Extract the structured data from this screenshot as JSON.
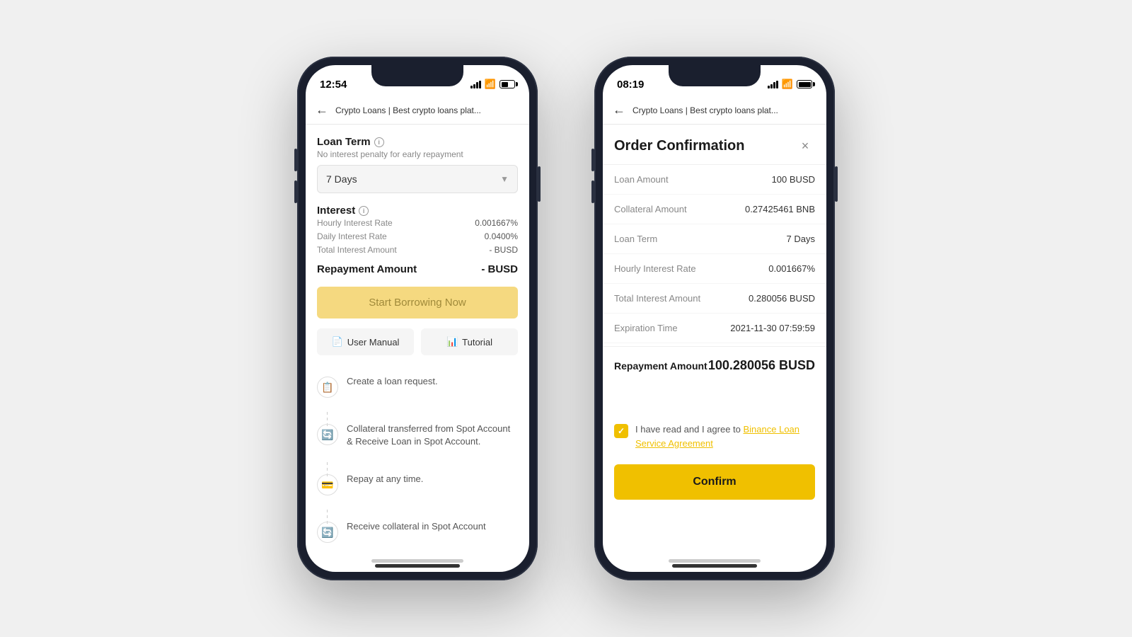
{
  "phone1": {
    "status": {
      "time": "12:54",
      "battery": "partial"
    },
    "browser": {
      "url": "Crypto Loans | Best crypto loans plat..."
    },
    "loanTerm": {
      "label": "Loan Term",
      "tooltip": "i",
      "subtext": "No interest penalty for early repayment",
      "selected": "7 Days"
    },
    "interest": {
      "label": "Interest",
      "tooltip": "i",
      "rows": [
        {
          "label": "Hourly Interest Rate",
          "value": "0.001667%"
        },
        {
          "label": "Daily Interest Rate",
          "value": "0.0400%"
        },
        {
          "label": "Total Interest Amount",
          "value": "- BUSD"
        }
      ]
    },
    "repayment": {
      "label": "Repayment Amount",
      "value": "- BUSD"
    },
    "borrowBtn": "Start Borrowing Now",
    "actionButtons": [
      {
        "label": "User Manual",
        "icon": "📄"
      },
      {
        "label": "Tutorial",
        "icon": "📊"
      }
    ],
    "steps": [
      {
        "text": "Create a loan request.",
        "icon": "📋"
      },
      {
        "text": "Collateral transferred from Spot Account & Receive Loan in Spot Account.",
        "icon": "🔄"
      },
      {
        "text": "Repay at any time.",
        "icon": "💳"
      },
      {
        "text": "Receive collateral in Spot Account",
        "icon": "🔄"
      }
    ]
  },
  "phone2": {
    "status": {
      "time": "08:19",
      "battery": "full"
    },
    "browser": {
      "url": "Crypto Loans | Best crypto loans plat..."
    },
    "modal": {
      "title": "Order Confirmation",
      "close": "×",
      "details": [
        {
          "label": "Loan Amount",
          "value": "100 BUSD"
        },
        {
          "label": "Collateral Amount",
          "value": "0.27425461 BNB"
        },
        {
          "label": "Loan Term",
          "value": "7 Days"
        },
        {
          "label": "Hourly Interest Rate",
          "value": "0.001667%"
        },
        {
          "label": "Total Interest Amount",
          "value": "0.280056 BUSD"
        },
        {
          "label": "Expiration Time",
          "value": "2021-11-30 07:59:59"
        }
      ],
      "repayment": {
        "label": "Repayment Amount",
        "value": "100.280056 BUSD"
      },
      "agreementText": "I have read and I agree to ",
      "agreementLink": "Binance Loan Service Agreement",
      "confirmBtn": "Confirm"
    }
  }
}
